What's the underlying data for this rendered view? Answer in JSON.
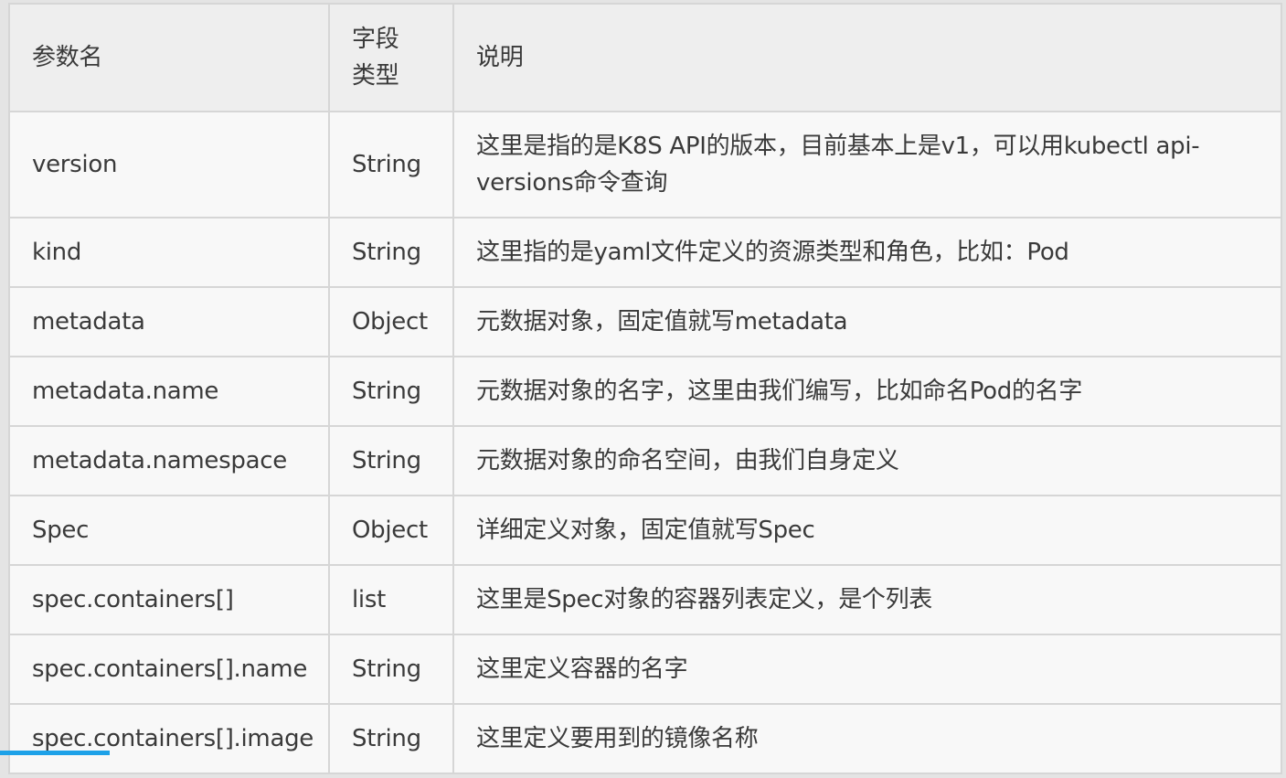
{
  "table": {
    "headers": {
      "name": "参数名",
      "type": "字段类型",
      "description": "说明"
    },
    "rows": [
      {
        "name": "version",
        "type": "String",
        "description": "这里是指的是K8S API的版本，目前基本上是v1，可以用kubectl  api-versions命令查询"
      },
      {
        "name": "kind",
        "type": "String",
        "description": "这里指的是yaml文件定义的资源类型和角色，比如：Pod"
      },
      {
        "name": "metadata",
        "type": "Object",
        "description": "元数据对象，固定值就写metadata"
      },
      {
        "name": "metadata.name",
        "type": "String",
        "description": "元数据对象的名字，这里由我们编写，比如命名Pod的名字"
      },
      {
        "name": "metadata.namespace",
        "type": "String",
        "description": "元数据对象的命名空间，由我们自身定义"
      },
      {
        "name": "Spec",
        "type": "Object",
        "description": "详细定义对象，固定值就写Spec"
      },
      {
        "name": "spec.containers[]",
        "type": "list",
        "description": "这里是Spec对象的容器列表定义，是个列表"
      },
      {
        "name": "spec.containers[].name",
        "type": "String",
        "description": "这里定义容器的名字"
      },
      {
        "name": "spec.containers[].image",
        "type": "String",
        "description": "这里定义要用到的镜像名称"
      }
    ]
  },
  "video_progress": {
    "fraction": 0.085,
    "color": "#1da1e8"
  }
}
